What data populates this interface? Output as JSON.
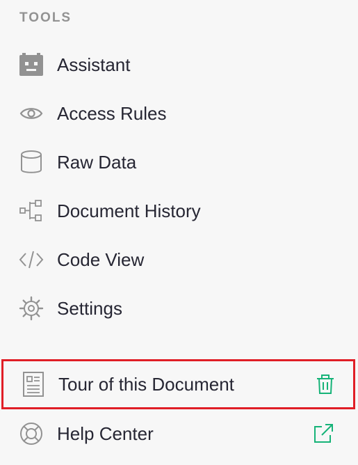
{
  "tools_section": {
    "header": "TOOLS",
    "items": [
      {
        "label": "Assistant",
        "icon": "robot-icon"
      },
      {
        "label": "Access Rules",
        "icon": "eye-icon"
      },
      {
        "label": "Raw Data",
        "icon": "database-icon"
      },
      {
        "label": "Document History",
        "icon": "history-tree-icon"
      },
      {
        "label": "Code View",
        "icon": "code-icon"
      },
      {
        "label": "Settings",
        "icon": "gear-icon"
      }
    ]
  },
  "bottom_section": {
    "items": [
      {
        "label": "Tour of this Document",
        "icon": "document-tour-icon",
        "action_icon": "trash-icon"
      },
      {
        "label": "Help Center",
        "icon": "lifebuoy-icon",
        "action_icon": "external-link-icon"
      }
    ]
  },
  "colors": {
    "background": "#f7f7f7",
    "text": "#262633",
    "header_text": "#929292",
    "icon_gray": "#929292",
    "accent_green": "#16b378",
    "highlight_border": "#e01e26"
  }
}
